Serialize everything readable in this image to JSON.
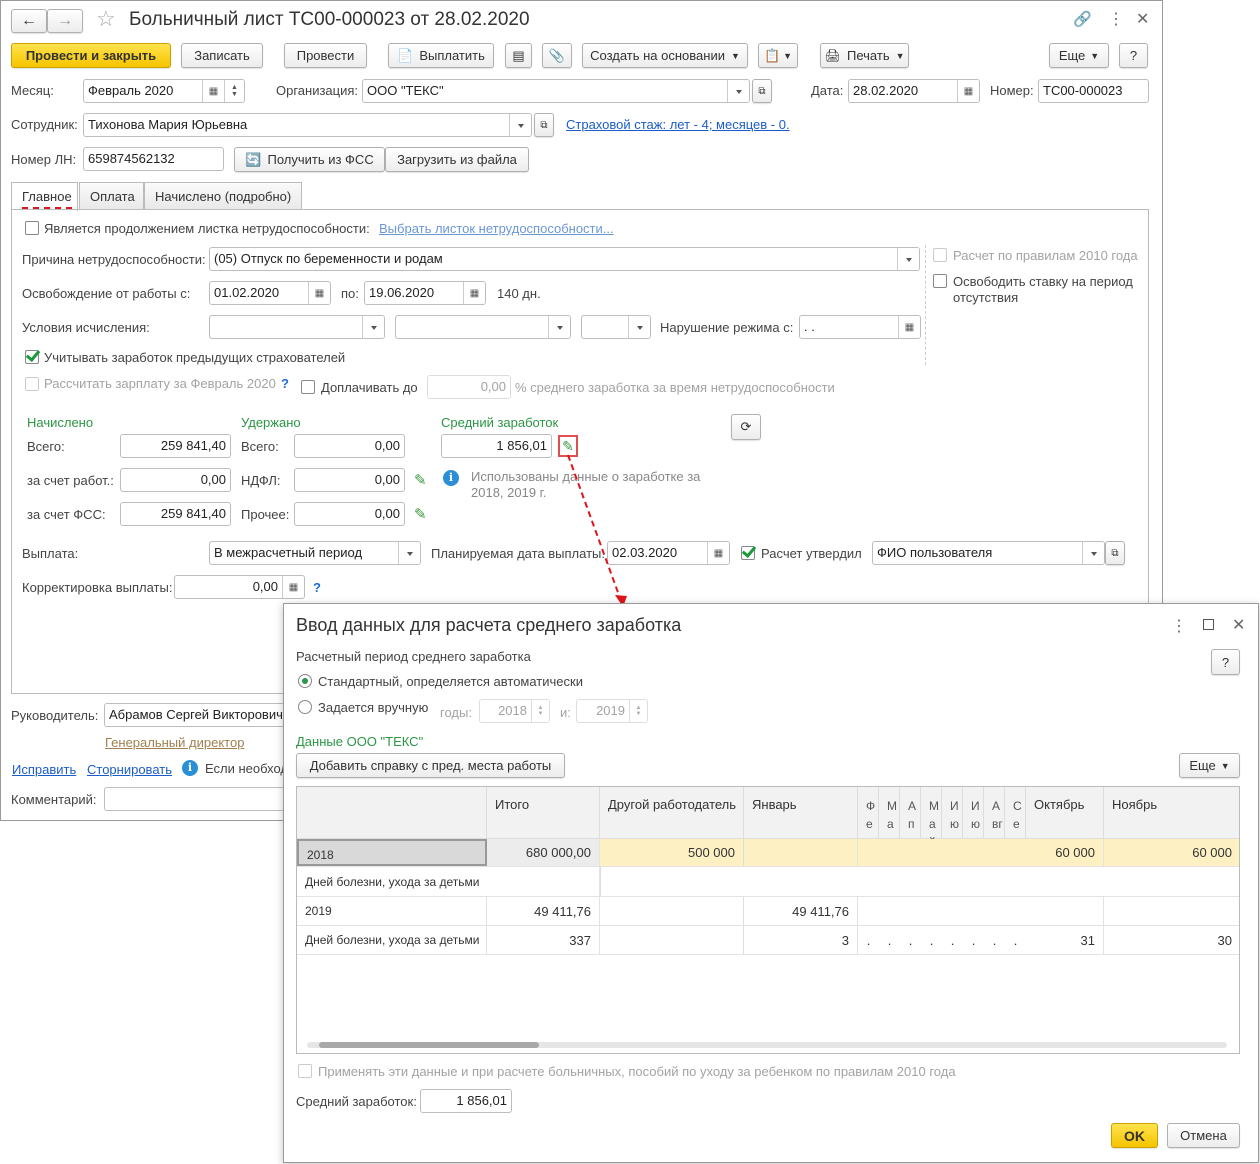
{
  "window": {
    "title": "Больничный лист ТС00-000023 от 28.02.2020"
  },
  "toolbar": {
    "post_close": "Провести и закрыть",
    "save": "Записать",
    "post": "Провести",
    "pay": "Выплатить",
    "create_based": "Создать на основании",
    "print": "Печать",
    "more": "Еще",
    "help": "?"
  },
  "header": {
    "month_label": "Месяц:",
    "month": "Февраль 2020",
    "org_label": "Организация:",
    "org": "ООО \"ТЕКС\"",
    "date_label": "Дата:",
    "date": "28.02.2020",
    "number_label": "Номер:",
    "number": "ТС00-000023",
    "employee_label": "Сотрудник:",
    "employee": "Тихонова Мария Юрьевна",
    "insurance_link": "Страховой стаж: лет - 4; месяцев - 0.",
    "ln_label": "Номер ЛН:",
    "ln": "659874562132",
    "get_fss": "Получить из ФСС",
    "load_file": "Загрузить из файла"
  },
  "tabs": [
    {
      "label": "Главное",
      "active": true
    },
    {
      "label": "Оплата"
    },
    {
      "label": "Начислено (подробно)"
    }
  ],
  "main": {
    "continuation": "Является продолжением листка нетрудоспособности:",
    "choose_link": "Выбрать листок нетрудоспособности...",
    "reason_label": "Причина нетрудоспособности:",
    "reason": "(05) Отпуск по беременности и родам",
    "release_label": "Освобождение от работы с:",
    "from": "01.02.2020",
    "to_label": "по:",
    "to": "19.06.2020",
    "days": "140 дн.",
    "conditions_label": "Условия исчисления:",
    "violation_label": "Нарушение режима с:",
    "violation": " .  .",
    "rules2010": "Расчет по правилам 2010 года",
    "free_rate": "Освободить ставку на период отсутствия",
    "prev_insurers": "Учитывать заработок предыдущих страхователей",
    "calc_salary": "Рассчитать зарплату за Февраль 2020",
    "extra_pay": "Доплачивать до",
    "extra_value": "0,00",
    "extra_suffix": "% среднего заработка за время нетрудоспособности",
    "q": "?",
    "accrued_title": "Начислено",
    "total_label": "Всего:",
    "total": "259 841,40",
    "employer_label": "за счет работ.:",
    "employer": "0,00",
    "fss_label": "за счет ФСС:",
    "fss": "259 841,40",
    "withheld_title": "Удержано",
    "w_total_label": "Всего:",
    "w_total": "0,00",
    "ndfl_label": "НДФЛ:",
    "ndfl": "0,00",
    "other_label": "Прочее:",
    "other": "0,00",
    "avg_title": "Средний заработок",
    "avg": "1 856,01",
    "avg_info": "Использованы данные о заработке за 2018,  2019 г.",
    "payout_label": "Выплата:",
    "payout": "В межрасчетный период",
    "plan_date_label": "Планируемая дата выплаты:",
    "plan_date": "02.03.2020",
    "approved_label": "Расчет утвердил",
    "approved": "ФИО пользователя",
    "correction_label": "Корректировка выплаты:",
    "correction": "0,00"
  },
  "footer": {
    "head_label": "Руководитель:",
    "head": "Абрамов Сергей Викторович",
    "position": "Генеральный директор",
    "fix": "Исправить",
    "reverse": "Сторнировать",
    "info": "Если необход",
    "comment_label": "Комментарий:"
  },
  "dialog": {
    "title": "Ввод данных для расчета среднего заработка",
    "period_label": "Расчетный период среднего заработка",
    "standard": "Стандартный, определяется автоматически",
    "manual": "Задается вручную",
    "years_label": "годы:",
    "year1": "2018",
    "and_label": "и:",
    "year2": "2019",
    "company": "Данные ООО \"ТЕКС\"",
    "add_cert": "Добавить справку с пред. места работы",
    "more": "Еще",
    "help": "?",
    "columns": [
      "",
      "Итого",
      "Другой работодатель",
      "Январь",
      "Февраль",
      "Март",
      "Апрель",
      "Май",
      "Июнь",
      "Июль",
      "Август",
      "Сентябрь",
      "Октябрь",
      "Ноябрь"
    ],
    "rows": [
      {
        "cells": [
          "2018",
          "680 000,00",
          "500 000",
          "",
          "",
          "",
          "",
          "",
          "",
          "",
          "",
          "",
          "60 000",
          "60 000"
        ],
        "highlight": true
      },
      {
        "cells": [
          "Дней болезни, ухода за детьми"
        ],
        "span": true
      },
      {
        "cells": [
          "2019",
          "49 411,76",
          "",
          "49 411,76",
          "",
          "",
          "",
          "",
          "",
          "",
          "",
          "",
          "",
          ""
        ]
      },
      {
        "cells": [
          "Дней болезни, ухода за детьми",
          "337",
          "",
          "3",
          ".",
          ".",
          ".",
          ".",
          ".",
          ".",
          ".",
          ".",
          "31",
          "30"
        ]
      }
    ],
    "apply_2010": "Применять эти данные и при расчете больничных, пособий по уходу за ребенком по правилам 2010 года",
    "avg_label": "Средний заработок:",
    "avg": "1 856,01",
    "ok": "OK",
    "cancel": "Отмена"
  },
  "colors": {
    "accent_yellow": "#f6c400",
    "green": "#2b9645",
    "link": "#1b5cc9",
    "highlight_row": "#fdf1c4",
    "arrow": "#e0141b"
  }
}
